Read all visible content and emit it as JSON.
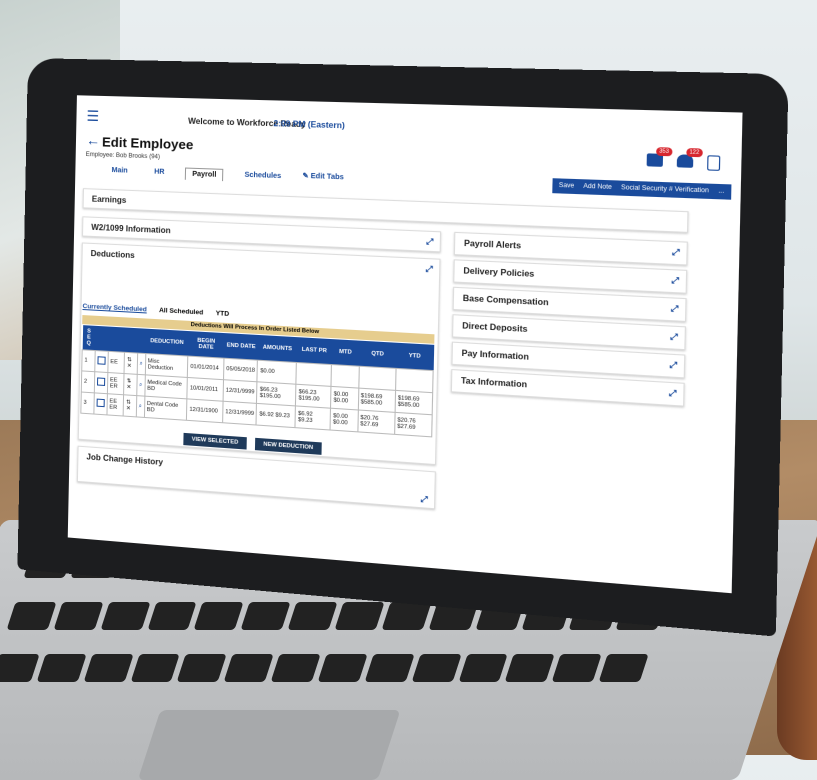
{
  "header": {
    "welcome": "Welcome to Workforce Ready",
    "time": "2:09 PM (Eastern)",
    "title": "Edit Employee",
    "subtitle": "Employee: Bob Brooks (94)",
    "mail_badge": "353",
    "bell_badge": "122"
  },
  "tabs": [
    {
      "label": "Main"
    },
    {
      "label": "HR"
    },
    {
      "label": "Payroll"
    },
    {
      "label": "Schedules"
    }
  ],
  "edit_tabs_label": "Edit Tabs",
  "actions": [
    "Save",
    "Add Note",
    "Social Security # Verification",
    "..."
  ],
  "left_sections": {
    "earnings": "Earnings",
    "w2": "W2/1099 Information",
    "deductions": "Deductions",
    "job_change": "Job Change History"
  },
  "sub_tabs": [
    "Currently Scheduled",
    "All Scheduled",
    "YTD"
  ],
  "banner": "Deductions Will Process In Order Listed Below",
  "table": {
    "headers": [
      "S E Q",
      "",
      "",
      "",
      "",
      "DEDUCTION",
      "BEGIN DATE",
      "END DATE",
      "AMOUNTS",
      "LAST PR",
      "MTD",
      "QTD",
      "YTD"
    ],
    "rows": [
      [
        "1",
        "",
        "EE",
        "",
        "",
        "Misc Deduction",
        "01/01/2014",
        "05/05/2018",
        "$0.00",
        "",
        "",
        "",
        ""
      ],
      [
        "2",
        "",
        "EE ER",
        "",
        "",
        "Medical Code BD",
        "10/01/2011",
        "12/31/9999",
        "$66.23 $195.00",
        "$66.23 $195.00",
        "$0.00 $0.00",
        "$198.69 $585.00",
        "$198.69 $585.00"
      ],
      [
        "3",
        "",
        "EE ER",
        "",
        "",
        "Dental Code BD",
        "12/31/1900",
        "12/31/9999",
        "$6.92 $9.23",
        "$6.92 $9.23",
        "$0.00 $0.00",
        "$20.76 $27.69",
        "$20.76 $27.69"
      ]
    ]
  },
  "buttons": {
    "view": "VIEW SELECTED",
    "new": "NEW DEDUCTION"
  },
  "right_sections": [
    "Payroll Alerts",
    "Delivery Policies",
    "Base Compensation",
    "Direct Deposits",
    "Pay Information",
    "Tax Information"
  ],
  "colors": {
    "accent": "#1a4b9c",
    "banner": "#e6cd8e",
    "badge": "#d7262e"
  }
}
